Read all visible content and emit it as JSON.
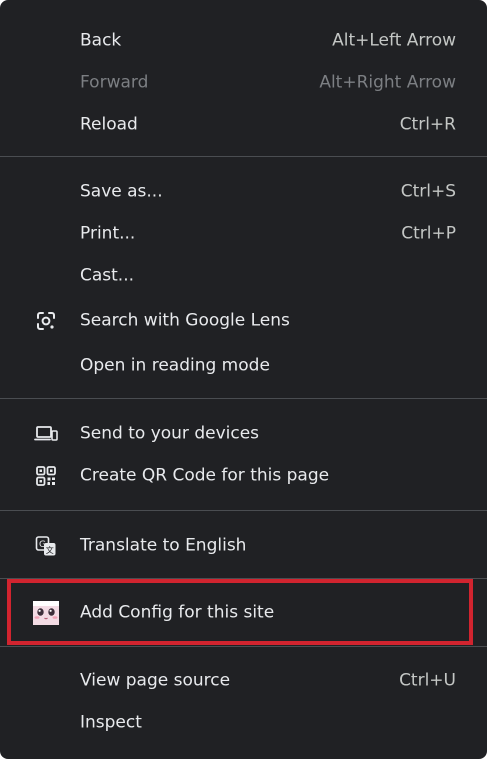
{
  "menu": {
    "back": {
      "label": "Back",
      "shortcut": "Alt+Left Arrow"
    },
    "forward": {
      "label": "Forward",
      "shortcut": "Alt+Right Arrow"
    },
    "reload": {
      "label": "Reload",
      "shortcut": "Ctrl+R"
    },
    "save_as": {
      "label": "Save as...",
      "shortcut": "Ctrl+S"
    },
    "print": {
      "label": "Print...",
      "shortcut": "Ctrl+P"
    },
    "cast": {
      "label": "Cast..."
    },
    "google_lens": {
      "label": "Search with Google Lens",
      "icon": "google-lens-icon"
    },
    "reading_mode": {
      "label": "Open in reading mode"
    },
    "send_devices": {
      "label": "Send to your devices",
      "icon": "devices-icon"
    },
    "qr_code": {
      "label": "Create QR Code for this page",
      "icon": "qr-code-icon"
    },
    "translate": {
      "label": "Translate to English",
      "icon": "translate-icon"
    },
    "add_config": {
      "label": "Add Config for this site",
      "icon": "extension-avatar-icon"
    },
    "view_source": {
      "label": "View page source",
      "shortcut": "Ctrl+U"
    },
    "inspect": {
      "label": "Inspect"
    }
  },
  "colors": {
    "menu_background": "#202124",
    "text": "#e8eaed",
    "disabled_text": "#7c7f83",
    "separator": "#4a4d51",
    "highlight_border": "#d1242f"
  }
}
